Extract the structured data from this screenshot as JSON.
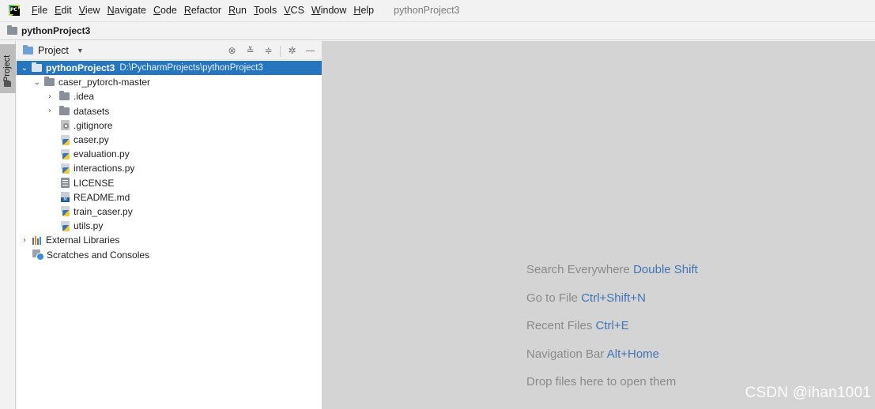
{
  "menubar": {
    "items": [
      "File",
      "Edit",
      "View",
      "Navigate",
      "Code",
      "Refactor",
      "Run",
      "Tools",
      "VCS",
      "Window",
      "Help"
    ],
    "project_title": "pythonProject3"
  },
  "navbar": {
    "crumb": "pythonProject3"
  },
  "sidestrip": {
    "tab_label": "Project"
  },
  "panel": {
    "title": "Project",
    "icons": [
      "locate-icon",
      "expand-all-icon",
      "collapse-all-icon",
      "gear-icon",
      "hide-icon"
    ]
  },
  "tree": {
    "root": {
      "label": "pythonProject3",
      "path": "D:\\PycharmProjects\\pythonProject3"
    },
    "folder": "caser_pytorch-master",
    "subfolders": [
      ".idea",
      "datasets"
    ],
    "files": [
      {
        "label": ".gitignore",
        "icon": "gitignore-icon"
      },
      {
        "label": "caser.py",
        "icon": "python-file-icon"
      },
      {
        "label": "evaluation.py",
        "icon": "python-file-icon"
      },
      {
        "label": "interactions.py",
        "icon": "python-file-icon"
      },
      {
        "label": "LICENSE",
        "icon": "text-file-icon"
      },
      {
        "label": "README.md",
        "icon": "markdown-file-icon"
      },
      {
        "label": "train_caser.py",
        "icon": "python-file-icon"
      },
      {
        "label": "utils.py",
        "icon": "python-file-icon"
      }
    ],
    "external_libraries": "External Libraries",
    "scratches": "Scratches and Consoles"
  },
  "editor": {
    "hints": [
      {
        "text": "Search Everywhere",
        "key": "Double Shift"
      },
      {
        "text": "Go to File",
        "key": "Ctrl+Shift+N"
      },
      {
        "text": "Recent Files",
        "key": "Ctrl+E"
      },
      {
        "text": "Navigation Bar",
        "key": "Alt+Home"
      },
      {
        "text": "Drop files here to open them",
        "key": ""
      }
    ]
  },
  "watermark": "CSDN @ihan1001"
}
